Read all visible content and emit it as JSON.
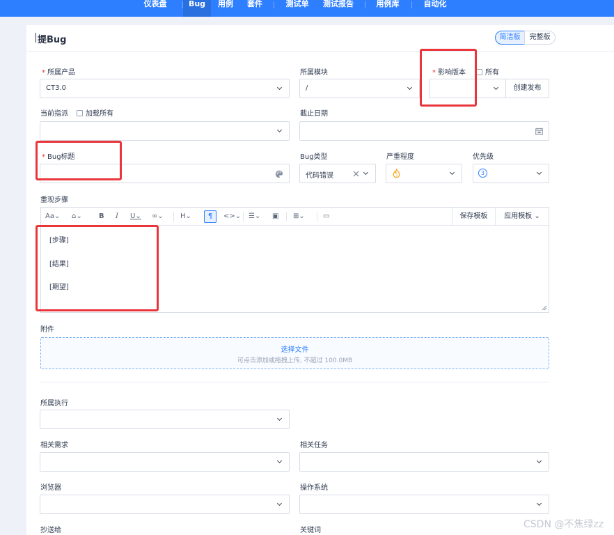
{
  "nav": {
    "items": [
      "仪表盘",
      "Bug",
      "用例",
      "套件",
      "测试单",
      "测试报告",
      "用例库",
      "自动化"
    ],
    "active": "Bug"
  },
  "page": {
    "title": "提Bug",
    "mode_simple": "简洁版",
    "mode_full": "完整版"
  },
  "form": {
    "product": {
      "label": "所属产品",
      "value": "CT3.0"
    },
    "module": {
      "label": "所属模块",
      "value": "/"
    },
    "build": {
      "label": "影响版本",
      "all_label": "所有",
      "create_button": "创建发布"
    },
    "assignee": {
      "label": "当前指派",
      "load_all_label": "加载所有"
    },
    "deadline": {
      "label": "截止日期"
    },
    "title": {
      "label": "Bug标题"
    },
    "type": {
      "label": "Bug类型",
      "value": "代码错误"
    },
    "severity": {
      "label": "严重程度"
    },
    "priority": {
      "label": "优先级",
      "value": "3"
    },
    "steps": {
      "label": "重现步骤",
      "toolbar": {
        "save_template": "保存模板",
        "apply_template": "应用模板"
      },
      "content": [
        "[步骤]",
        "[结果]",
        "[期望]"
      ]
    },
    "attachment": {
      "label": "附件",
      "select": "选择文件",
      "hint": "可点击添加或拖拽上传, 不超过 100.0MB"
    },
    "execution": {
      "label": "所属执行"
    },
    "story": {
      "label": "相关需求"
    },
    "task": {
      "label": "相关任务"
    },
    "browser": {
      "label": "浏览器"
    },
    "os": {
      "label": "操作系统"
    },
    "mailto": {
      "label": "抄送给"
    },
    "keywords": {
      "label": "关键词"
    }
  },
  "watermark": "CSDN @不焦绿zz",
  "colors": {
    "accent": "#2e7fff",
    "highlight": "#e8363c",
    "required": "#e83737"
  }
}
